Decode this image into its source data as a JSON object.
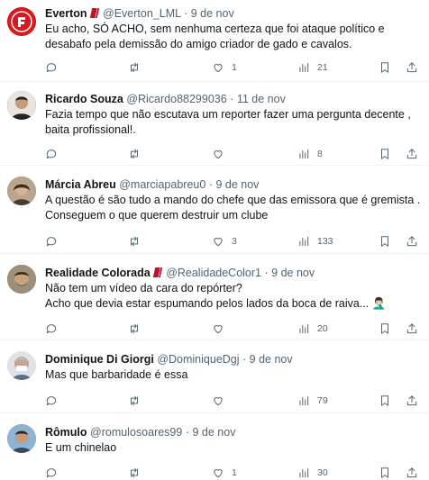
{
  "tweets": [
    {
      "name": "Everton",
      "flag": true,
      "handle": "@Everton_LML",
      "date": "9 de nov",
      "text": "Eu acho, SÓ ACHO, sem nenhuma certeza que foi ataque político e desabafo pela demissão do amigo criador de gado e cavalos.",
      "replies": "",
      "retweets": "",
      "likes": "1",
      "views": "21",
      "avatar_color": "#d71920"
    },
    {
      "name": "Ricardo Souza",
      "flag": false,
      "handle": "@Ricardo88299036",
      "date": "11 de nov",
      "text": "Fazia tempo que não escutava um reporter fazer uma pergunta decente , baita profissional!.",
      "replies": "",
      "retweets": "",
      "likes": "",
      "views": "8",
      "avatar_color": "#3a2f2a"
    },
    {
      "name": "Márcia Abreu",
      "flag": false,
      "handle": "@marciapabreu0",
      "date": "9 de nov",
      "text": "A questão é são tudo a mando do chefe que das emissora que é gremista . Conseguem o que querem destruir um clube",
      "replies": "",
      "retweets": "",
      "likes": "3",
      "views": "133",
      "avatar_color": "#8a6a4a"
    },
    {
      "name": "Realidade Colorada",
      "flag": true,
      "handle": "@RealidadeColor1",
      "date": "9 de nov",
      "text": "Não tem um vídeo da cara do repórter?\nAcho que devia estar espumando pelos lados da boca de raiva... 🤦🏻‍♂️",
      "replies": "",
      "retweets": "",
      "likes": "",
      "views": "20",
      "avatar_color": "#7a6a55"
    },
    {
      "name": "Dominique Di Giorgi",
      "flag": false,
      "handle": "@DominiqueDgj",
      "date": "9 de nov",
      "text": "Mas que barbaridade é essa",
      "replies": "",
      "retweets": "",
      "likes": "",
      "views": "79",
      "avatar_color": "#c9ccd0"
    },
    {
      "name": "Rômulo",
      "flag": false,
      "handle": "@romulosoares99",
      "date": "9 de nov",
      "text": "E um chinelao",
      "replies": "",
      "retweets": "",
      "likes": "1",
      "views": "30",
      "avatar_color": "#6d8fb0"
    }
  ],
  "separator": "·",
  "icons": [
    "reply-icon",
    "retweet-icon",
    "like-icon",
    "views-icon",
    "bookmark-icon",
    "share-icon"
  ]
}
